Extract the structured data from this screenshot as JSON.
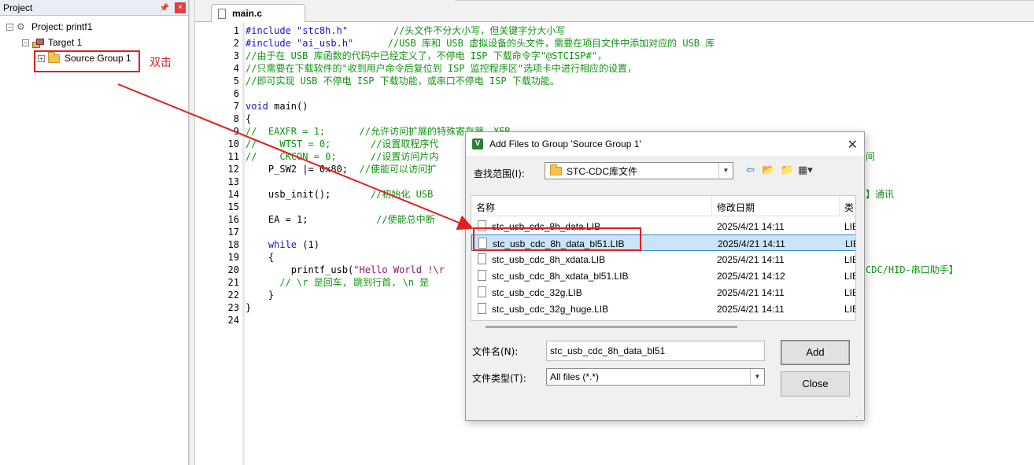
{
  "project_pane": {
    "title": "Project",
    "pin_label": "ᵖ",
    "close_label": "×",
    "project_label": "Project: printf1",
    "target_label": "Target 1",
    "group_label": "Source Group 1"
  },
  "annotation": {
    "double_click_label": "双击",
    "color": "#e02020"
  },
  "editor": {
    "tab_label": "main.c",
    "line_numbers": [
      "1",
      "2",
      "3",
      "4",
      "5",
      "6",
      "7",
      "8",
      "9",
      "10",
      "11",
      "12",
      "13",
      "14",
      "15",
      "16",
      "17",
      "18",
      "19",
      "20",
      "21",
      "22",
      "23",
      "24"
    ],
    "lines": {
      "l1a": "#include \"stc8h.h\"",
      "l1b": "        //头文件不分大小写，但关键字分大小写",
      "l2a": "#include \"ai_usb.h\"",
      "l2b": "      //USB 库和 USB 虚拟设备的头文件，需要在项目文件中添加对应的 USB 库",
      "l3": "//由于在 USB 库函数的代码中已经定义了，不停电 ISP 下载命令字\"@STCISP#\"，",
      "l4": "//只需要在下载软件的\"收到用户命令后复位到 ISP 监控程序区\"选项卡中进行相应的设置，",
      "l5": "//即可实现 USB 不停电 ISP 下载功能，或串口不停电 ISP 下载功能。",
      "l7a": "void",
      "l7b": " main()",
      "l8": "{",
      "l9": "//  EAXFR = 1;      //允许访问扩展的特殊寄存器，XFR",
      "l10": "//    WTST = 0;       //设置取程序代",
      "l11": "//    CKCON = 0;      //设置访问片内",
      "l11r": "间",
      "l12a": "    P_SW2 |= 0x80;  ",
      "l12b": "//使能可以访问扩",
      "l14a": "    usb_init();       ",
      "l14b": "//初始化 USB",
      "l14r": "】通讯",
      "l16a": "    EA = 1;            ",
      "l16b": "//使能总中断",
      "l18a": "    ",
      "l18b": "while",
      "l18c": " (1)",
      "l19": "    {",
      "l20a": "        printf_usb(",
      "l20b": "\"Hello World !\\r",
      "l20r": "CDC/HID-串口助手】",
      "l21": "      // \\r 是回车, 跳到行首, \\n 是",
      "l22": "    }",
      "l23": "}"
    }
  },
  "dialog": {
    "title": "Add Files to Group 'Source Group 1'",
    "close_label": "✕",
    "look_in_label": "查找范围(I):",
    "look_in_value": "STC-CDC库文件",
    "columns": [
      "名称",
      "修改日期",
      "类"
    ],
    "files": [
      {
        "name": "stc_usb_cdc_8h_data.LIB",
        "date": "2025/4/21 14:11",
        "type": "LIE"
      },
      {
        "name": "stc_usb_cdc_8h_data_bl51.LIB",
        "date": "2025/4/21 14:11",
        "type": "LIE"
      },
      {
        "name": "stc_usb_cdc_8h_xdata.LIB",
        "date": "2025/4/21 14:11",
        "type": "LIE"
      },
      {
        "name": "stc_usb_cdc_8h_xdata_bl51.LIB",
        "date": "2025/4/21 14:12",
        "type": "LIE"
      },
      {
        "name": "stc_usb_cdc_32g.LIB",
        "date": "2025/4/21 14:11",
        "type": "LIE"
      },
      {
        "name": "stc_usb_cdc_32g_huge.LIB",
        "date": "2025/4/21 14:11",
        "type": "LIE"
      }
    ],
    "selected_index": 1,
    "file_name_label": "文件名(N):",
    "file_name_value": "stc_usb_cdc_8h_data_bl51",
    "file_type_label": "文件类型(T):",
    "file_type_value": "All files (*.*)",
    "add_label": "Add",
    "close_button_label": "Close"
  }
}
